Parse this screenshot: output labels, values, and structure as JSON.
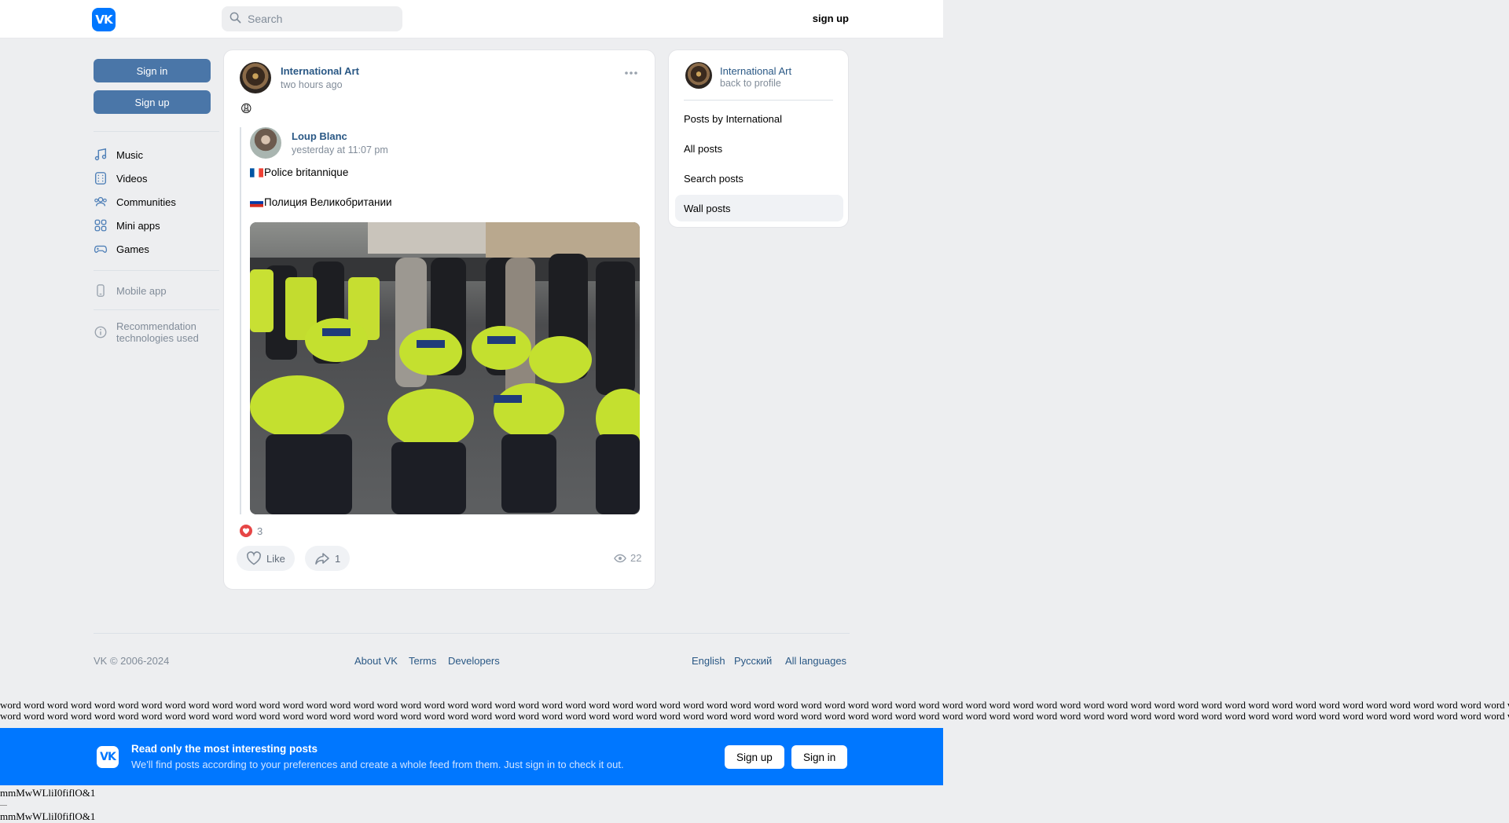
{
  "header": {
    "logo_text": "VK",
    "search_placeholder": "Search",
    "signup_label": "sign up"
  },
  "sidebar": {
    "sign_in": "Sign in",
    "sign_up": "Sign up",
    "items": [
      {
        "label": "Music",
        "icon": "music-icon"
      },
      {
        "label": "Videos",
        "icon": "video-icon"
      },
      {
        "label": "Communities",
        "icon": "communities-icon"
      },
      {
        "label": "Mini apps",
        "icon": "mini-apps-icon"
      },
      {
        "label": "Games",
        "icon": "gamepad-icon"
      }
    ],
    "mobile_app": "Mobile app",
    "recommendation_line1": "Recommendation",
    "recommendation_line2": "technologies used"
  },
  "post": {
    "author": "International Art",
    "time": "two hours ago",
    "emoji": "😩",
    "repost": {
      "author": "Loup Blanc",
      "time": "yesterday at 11:07 pm",
      "text_fr": "Police britannique",
      "text_ru": "Полиция Великобритании"
    },
    "reactions_count": "3",
    "like_label": "Like",
    "share_count": "1",
    "views": "22"
  },
  "right_panel": {
    "name": "International Art",
    "back": "back to profile",
    "items": [
      "Posts by International",
      "All posts",
      "Search posts",
      "Wall posts"
    ]
  },
  "footer": {
    "copyright": "VK © 2006-2024",
    "links": [
      "About VK",
      "Terms",
      "Developers"
    ],
    "languages": [
      "English",
      "Русский",
      "All languages"
    ]
  },
  "word_row": "word word word word word word word word word word word word word word word word word word word word word word word word word word word word word word word word word word word word word word word word word word word word word word word word word word word word word word word word word word word word word word word word word word word word word word word word word word word word word word word word word word word word word word word word word word word word word word word word",
  "banner": {
    "logo_text": "VK",
    "title": "Read only the most interesting posts",
    "subtitle": "We'll find posts according to your preferences and create a whole feed from them. Just sign in to check it out.",
    "sign_up": "Sign up",
    "sign_in": "Sign in"
  },
  "bottom_text": "mmMwWLliI0fiflO&1",
  "colors": {
    "accent": "#0077ff",
    "button": "#4a76a8",
    "link": "#2a5885"
  }
}
